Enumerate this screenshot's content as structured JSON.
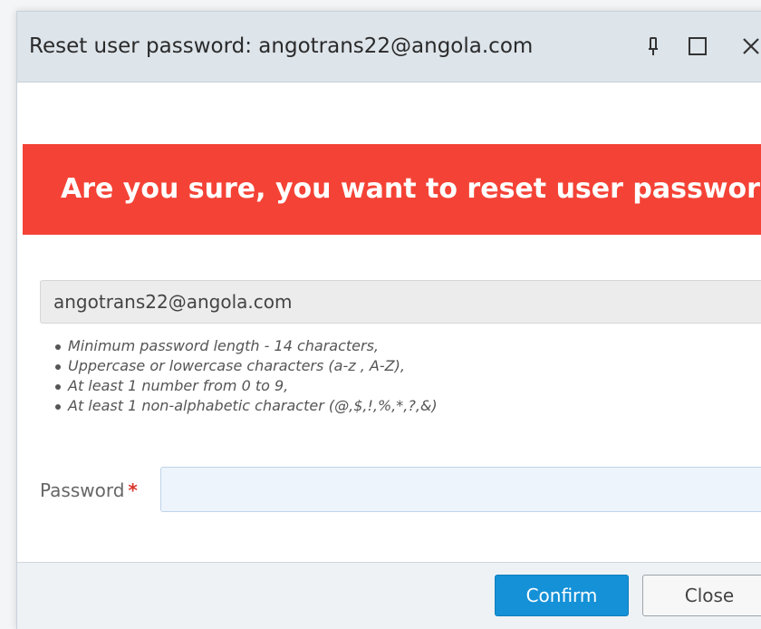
{
  "dialog": {
    "title": "Reset user password: angotrans22@angola.com",
    "controls": [
      "pin-icon",
      "maximize-icon",
      "close-icon"
    ]
  },
  "warning": {
    "text": "Are you sure, you want to reset user password?",
    "color": "#f44336"
  },
  "email": {
    "value": "angotrans22@angola.com"
  },
  "requirements": [
    "Minimum password length - 14 characters,",
    "Uppercase or lowercase characters (a-z , A-Z),",
    "At least 1 number from 0 to 9,",
    "At least 1 non-alphabetic character (@,$,!,%,*,?,&)"
  ],
  "password": {
    "label": "Password",
    "required_mark": "*",
    "value": ""
  },
  "buttons": {
    "confirm": "Confirm",
    "close": "Close"
  },
  "colors": {
    "accent": "#1591d7",
    "titlebar": "#dde4ea"
  }
}
